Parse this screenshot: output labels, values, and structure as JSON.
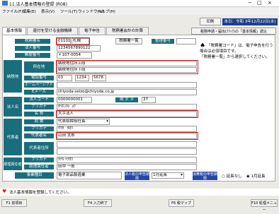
{
  "window": {
    "title": "11.法人基本情報の登録 (R08)"
  },
  "menu": [
    "ファイル(F)",
    "編集(E)",
    "表示(V)",
    "ツール(T)",
    "ウィンドウ(W)",
    "ヘルプ(H)"
  ],
  "toolbar": {
    "print": "印刷",
    "close": "終了",
    "date": "本日：令和 3年12月22日(水)"
  },
  "tabs": [
    "基本情報",
    "還付を受ける金融機関",
    "電子申告",
    "税務署会計の計算"
  ],
  "tax_office_button": "税務申請・届出(ｸﾘｯｸ)の「基本情報」読込",
  "form": {
    "tax_office_label": "税務署名",
    "tax_office_code": "01101",
    "tax_office_name": "札幌",
    "tax_office_list": "税務署一覧",
    "ref_number_label": "整理番号",
    "ref_number": "",
    "corp_number_label": "法人番号",
    "corp_number": "1234567890122",
    "postal_label": "郵便番号",
    "postal": "〒107-0054",
    "hq_section": "納税地",
    "address_label": "所在地",
    "address_line1": "納税地住所上段",
    "address_line2": "納税地住所下段",
    "phone_label": "電話番号",
    "phone1": "03",
    "phone2": "1234",
    "phone3": "5678",
    "homepage_label": "ホームページアドレス",
    "email_label": "Eメール",
    "email": "chiyoda-seizo@chiyoda.co.jp",
    "corp_section": "法人名",
    "corp_code_label": "法人コード",
    "corp_code": "0000000001",
    "fiscal_label": "期 文 字",
    "fiscal": "37",
    "furigana_label": "フリガナ",
    "furigana": "ﾀｲﾎﾝｶｼﾞｮｳ",
    "name_label": "名 称",
    "name": "大手法人",
    "rep_section": "代表者",
    "title_label": "肩 書",
    "title": "代表取締役社長",
    "rep_furigana_label": "フリガナ",
    "rep_furigana": "ﾔﾏﾀﾞ ﾀﾛｳ",
    "rep_name_label": "代表者名",
    "rep_name": "山田 太郎",
    "rep_address_label": "代表者住所",
    "acct_section": "経理責任者",
    "acct_furigana_label": "フリガナ",
    "acct_furigana": "ﾀﾅｶ ｲﾁﾛｳ",
    "acct_name_label": "経理責任者",
    "acct_name": "田中 一郎",
    "business_label": "事業種目",
    "business": "電子部品製造業",
    "doc_count_label": "法人税の申告期限",
    "month_value": "1月延長",
    "consumption_label": "消費税の申告期限",
    "none_label": "延長なし",
    "extension_label": "1月延長"
  },
  "note": {
    "marker": "♠",
    "line1": "「税務署コード」は、電子申告を行う場合は必須項目です。",
    "line2": "「税務署一覧」から選択してください。"
  },
  "status": "法人基本情報を登録してください。",
  "fkeys": [
    "F1 前項目",
    "F4 入力終了",
    "F6 税マップ",
    "F10 処理メニュー"
  ]
}
